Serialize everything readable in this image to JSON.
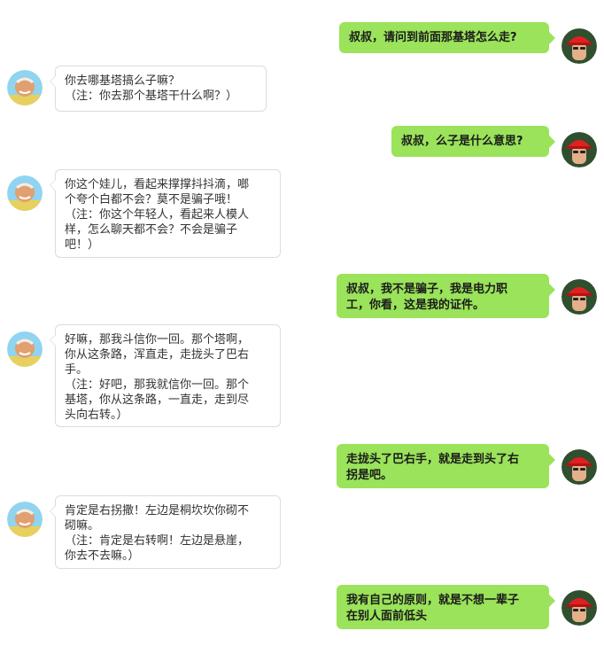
{
  "messages": [
    {
      "side": "right",
      "lines": [
        "叔叔，请问到前面那基塔怎么走?"
      ]
    },
    {
      "side": "left",
      "lines": [
        "你去哪基塔搞么子嘛？",
        "（注：你去那个基塔干什么啊？）"
      ]
    },
    {
      "side": "right",
      "lines": [
        "叔叔，么子是什么意思?"
      ]
    },
    {
      "side": "left",
      "lines": [
        "你这个娃儿，看起来撑撑抖抖滴，啷",
        "个夸个白都不会？莫不是骗子哦！",
        "（注：你这个年轻人，看起来人模人",
        "样，怎么聊天都不会？不会是骗子",
        "吧！）"
      ]
    },
    {
      "side": "right",
      "lines": [
        "叔叔，我不是骗子，我是电力职",
        "工，你看，这是我的证件。"
      ]
    },
    {
      "side": "left",
      "lines": [
        "好嘛，那我斗信你一回。那个塔啊，",
        "你从这条路，浑直走，走拢头了巴右",
        "手。",
        "（注：好吧，那我就信你一回。那个",
        "基塔，你从这条路，一直走，走到尽",
        "头向右转。）"
      ]
    },
    {
      "side": "right",
      "lines": [
        "走拢头了巴右手，就是走到头了右",
        "拐是吧。"
      ]
    },
    {
      "side": "left",
      "lines": [
        "肯定是右拐撒！左边是桐坎坎你砌不",
        "砌嘛。",
        "（注：肯定是右转啊！左边是悬崖，",
        "你去不去嘛。）"
      ]
    },
    {
      "side": "right",
      "lines": [
        "我有自己的原则，就是不想一辈子",
        "在别人面前低头"
      ]
    }
  ],
  "colors": {
    "right_bubble": "#9ae35a",
    "left_border": "#dcdcdc"
  }
}
